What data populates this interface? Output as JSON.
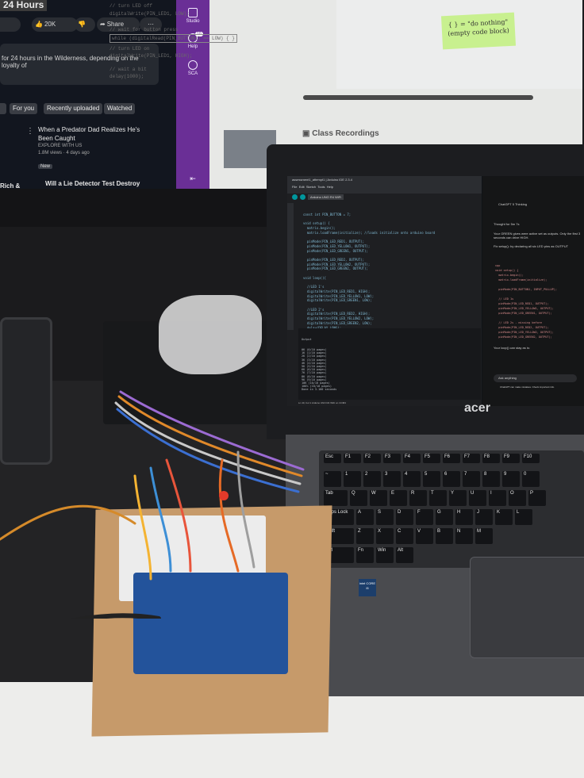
{
  "youtube": {
    "title_fragment": "24 Hours",
    "like_count": "20K",
    "share_label": "Share",
    "description_fragment": "for 24 hours in the Wilderness, depending on the loyalty of",
    "filter_chips": [
      "For you",
      "Recently uploaded",
      "Watched"
    ],
    "videos": [
      {
        "title": "When a Predator Dad Realizes He's Been Caught",
        "channel": "EXPLORE WITH US",
        "meta": "1.8M views · 4 days ago",
        "badge": "New"
      },
      {
        "title": "Will a Lie Detector Test Destroy These Couples? | The Hot Seat",
        "left_fragment": "Rich &"
      }
    ]
  },
  "sidebar": {
    "items": [
      {
        "label": "Studio",
        "icon": "studio-icon"
      },
      {
        "label": "Help",
        "icon": "help-icon",
        "badge": "10"
      },
      {
        "label": "SCA",
        "icon": "sca-icon"
      }
    ]
  },
  "slide": {
    "code_lines": [
      "// turn LED off",
      "digitalWrite(PIN_LED1, LOW);",
      "",
      "// wait for button press",
      "while (digitalRead(PIN_BUTTON1) == LOW) { }",
      "",
      "// turn LED on",
      "digitalWrite(PIN_LED1, HIGH);",
      "",
      "// wait a bit",
      "delay(1000);"
    ],
    "note_text": "{ } = \"do nothing\" (empty code block)",
    "class_recordings_label": "Class Recordings"
  },
  "ide": {
    "window_title": "assessment1_attempt1 | Arduino IDE 2.3.4",
    "menu": [
      "File",
      "Edit",
      "Sketch",
      "Tools",
      "Help"
    ],
    "board": "Arduino UNO R4 WiFi",
    "code": [
      "const int PIN_BUTTON = 7;",
      "",
      "void setup() {",
      "  matrix.begin();",
      "  matrix.loadFrame(initialize); //loads initialize onto arduino board",
      "",
      "  pinMode(PIN_LED_RED1, OUTPUT);",
      "  pinMode(PIN_LED_YELLOW1, OUTPUT);",
      "  pinMode(PIN_LED_GREEN1, OUTPUT);",
      "",
      "  pinMode(PIN_LED_RED2, OUTPUT);",
      "  pinMode(PIN_LED_YELLOW2, OUTPUT);",
      "  pinMode(PIN_LED_GREEN2, OUTPUT);",
      "",
      "void loop(){",
      "",
      "  //LED 1's",
      "  digitalWrite(PIN_LED_RED1, HIGH);",
      "  digitalWrite(PIN_LED_YELLOW1, LOW);",
      "  digitalWrite(PIN_LED_GREEN1, LOW);",
      "",
      "  //LED 2's",
      "  digitalWrite(PIN_LED_RED2, HIGH);",
      "  digitalWrite(PIN_LED_YELLOW2, LOW);",
      "  digitalWrite(PIN_LED_GREEN2, LOW);",
      "  delay(DELAY_LONG);"
    ],
    "output_label": "Output",
    "output_lines": [
      "0K (0/10 pages)",
      "1K (1/10 pages)",
      "2K (2/10 pages)",
      "3K (3/10 pages)",
      "4K (4/10 pages)",
      "5K (5/10 pages)",
      "6K (6/10 pages)",
      "7K (7/10 pages)",
      "8K (8/10 pages)",
      "9K (9/10 pages)",
      "10K (10/10 pages)",
      "100% (10/10 pages)",
      "Done in 3.100 seconds"
    ],
    "status": "Ln 40, Col 1   Arduino UNO R4 WiFi on COM3"
  },
  "chatgpt": {
    "header": "ChatGPT 5 Thinking",
    "thinking": "Thought for 5m 7s",
    "intro": "Your GREEN gives were active set as outputs. Only the first 3 seconds can drive HIGH.",
    "setup_hint": "Fix setup(): by declaring all six LED pins as OUTPUT",
    "code": [
      "cpp",
      "void setup() {",
      "  matrix.begin();",
      "  matrix.loadFrame(initialize);",
      "",
      "  pinMode(PIN_BUTTON1, INPUT_PULLUP);",
      "",
      "  // LED 1s",
      "  pinMode(PIN_LED_RED1, OUTPUT);",
      "  pinMode(PIN_LED_YELLOW1, OUTPUT);",
      "  pinMode(PIN_LED_GREEN1, OUTPUT);",
      "",
      "  // LED 2s - missing before",
      "  pinMode(PIN_LED_RED2, OUTPUT);",
      "  pinMode(PIN_LED_YELLOW2, OUTPUT);",
      "  pinMode(PIN_LED_GREEN2, OUTPUT);"
    ],
    "loop_hint": "Your loop() can stay as is:",
    "input_placeholder": "Ask anything",
    "disclaimer": "ChatGPT can make mistakes. Check important info."
  },
  "laptop": {
    "brand": "acer",
    "keys_row1": [
      "Esc",
      "F1",
      "F2",
      "F3",
      "F4",
      "F5",
      "F6",
      "F7",
      "F8",
      "F9",
      "F10"
    ],
    "keys_row2": [
      "~",
      "1",
      "2",
      "3",
      "4",
      "5",
      "6",
      "7",
      "8",
      "9",
      "0"
    ],
    "keys_row3": [
      "Tab",
      "Q",
      "W",
      "E",
      "R",
      "T",
      "Y",
      "U",
      "I",
      "O",
      "P"
    ],
    "keys_row4": [
      "Caps Lock",
      "A",
      "S",
      "D",
      "F",
      "G",
      "H",
      "J",
      "K",
      "L"
    ],
    "keys_row5": [
      "Shift",
      "Z",
      "X",
      "C",
      "V",
      "B",
      "N",
      "M"
    ],
    "keys_row6": [
      "Ctrl",
      "Fn",
      "Win",
      "Alt"
    ],
    "intel_sticker": "intel CORE i5"
  },
  "colors": {
    "sidebar_purple": "#6a2f96",
    "note_green": "#c8f08f",
    "arduino_blue": "#23539b",
    "cardboard": "#c69a6a"
  }
}
